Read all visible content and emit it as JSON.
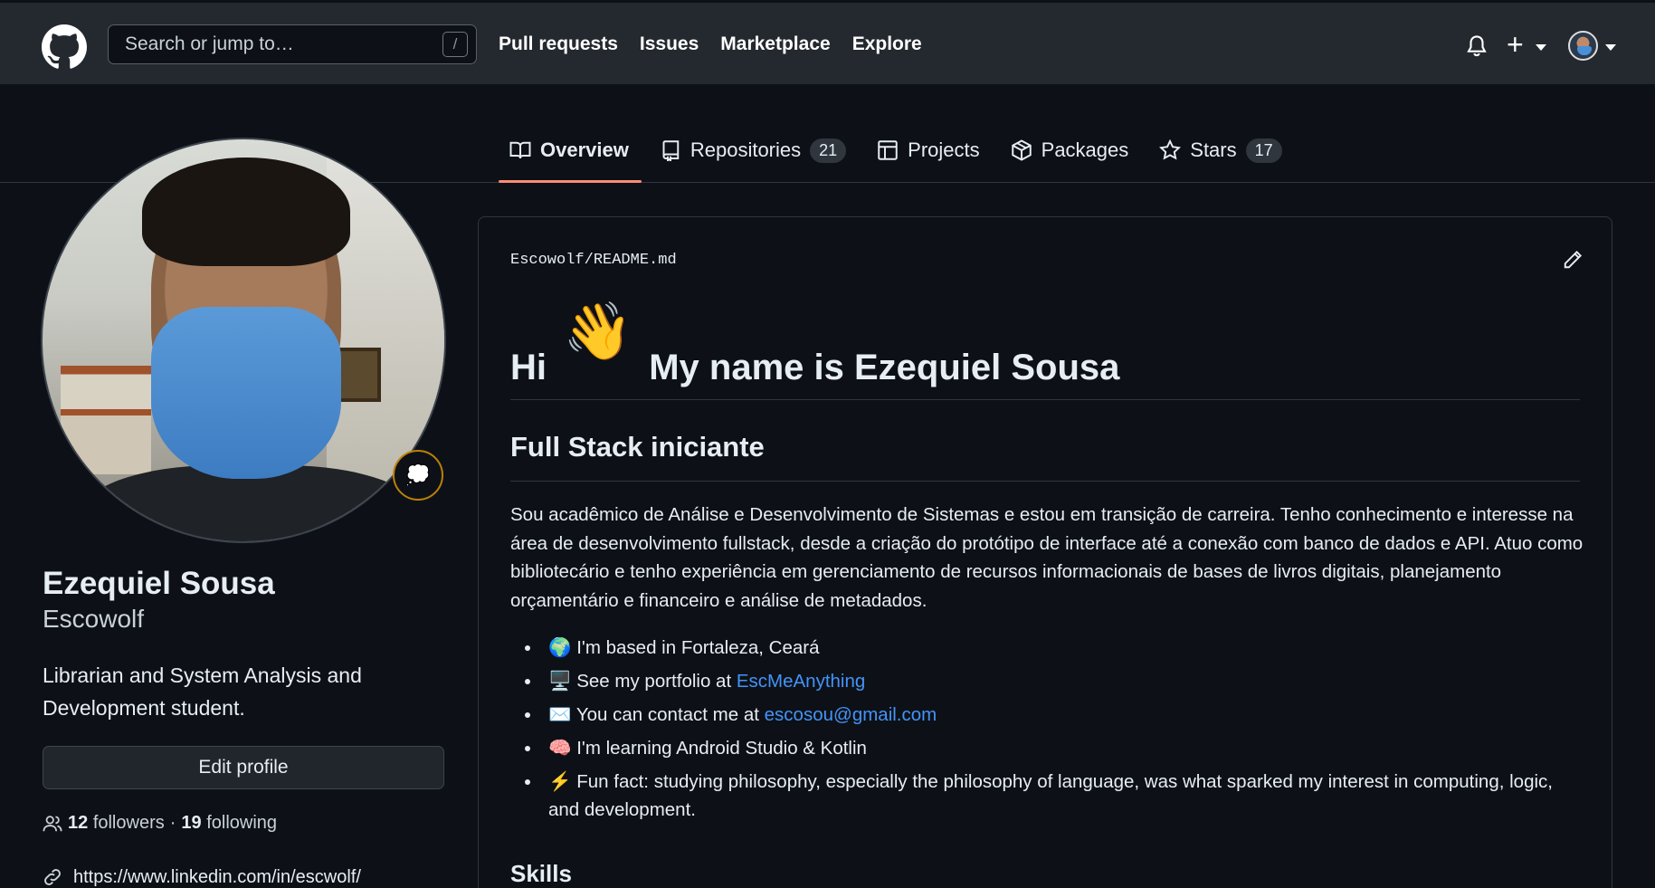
{
  "header": {
    "search_placeholder": "Search or jump to…",
    "search_shortcut": "/",
    "nav": [
      "Pull requests",
      "Issues",
      "Marketplace",
      "Explore"
    ],
    "plus_icon": "+"
  },
  "tabs": [
    {
      "label": "Overview",
      "icon": "book-icon"
    },
    {
      "label": "Repositories",
      "icon": "repo-icon",
      "count": "21"
    },
    {
      "label": "Projects",
      "icon": "table-icon"
    },
    {
      "label": "Packages",
      "icon": "package-icon"
    },
    {
      "label": "Stars",
      "icon": "star-icon",
      "count": "17"
    }
  ],
  "profile": {
    "name": "Ezequiel Sousa",
    "login": "Escowolf",
    "status_emoji": "💭",
    "bio": "Librarian and System Analysis and Development student.",
    "edit_label": "Edit profile",
    "followers_count": "12",
    "followers_label": "followers",
    "separator": "·",
    "following_count": "19",
    "following_label": "following",
    "link": "https://www.linkedin.com/in/escwolf/"
  },
  "readme": {
    "path_user": "Escowolf",
    "path_sep": "/",
    "path_file": "README.md",
    "h1_hi": "Hi",
    "h1_wave": "👋",
    "h1_rest": "My name is Ezequiel Sousa",
    "h2": "Full Stack iniciante",
    "paragraph": "Sou acadêmico de Análise e Desenvolvimento de Sistemas e estou em transição de carreira. Tenho conhecimento e interesse na área de desenvolvimento fullstack, desde a criação do protótipo de interface até a conexão com banco de dados e API. Atuo como bibliotecário e tenho experiência em gerenciamento de recursos informacionais de bases de livros digitais, planejamento orçamentário e financeiro e análise de metadados.",
    "items": [
      {
        "emoji": "🌍",
        "text": "I'm based in Fortaleza, Ceará",
        "link": ""
      },
      {
        "emoji": "🖥️",
        "text": "See my portfolio at ",
        "link": "EscMeAnything"
      },
      {
        "emoji": "✉️",
        "text": "You can contact me at ",
        "link": "escosou@gmail.com"
      },
      {
        "emoji": "🧠",
        "text": "I'm learning Android Studio & Kotlin",
        "link": ""
      },
      {
        "emoji": "⚡",
        "text": "Fun fact: studying philosophy, especially the philosophy of language, was what sparked my interest in computing, logic, and development.",
        "link": ""
      }
    ],
    "h3": "Skills"
  }
}
